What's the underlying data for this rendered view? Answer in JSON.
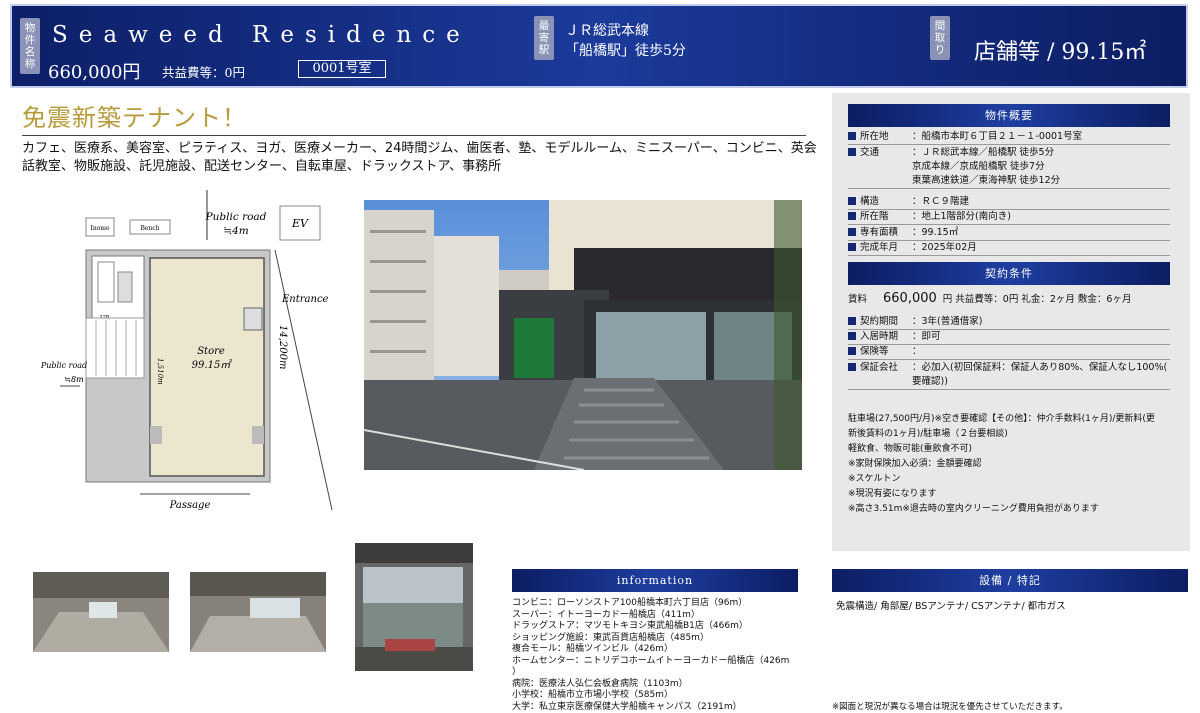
{
  "header": {
    "name_tag": "物件名称",
    "property_name": "Seaweed Residence",
    "price": "660,000円",
    "common_fee": "共益費等：0円",
    "room": "0001号室",
    "station_tag": "最寄駅",
    "line": "ＪＲ総武本線",
    "station": "「船橋駅」徒歩5分",
    "layout_tag": "間取り",
    "layout": "店舗等 / 99.15㎡"
  },
  "catchphrase": "免震新築テナント！",
  "uses": "カフェ、医療系、美容室、ピラティス、ヨガ、医療メーカー、24時間ジム、歯医者、塾、モデルルーム、ミニスーパー、コンビニ、英会話教室、物販施設、託児施設、配送センター、自転車屋、ドラックストア、事務所",
  "floorplan": {
    "inome": "Inome",
    "bench": "Bench",
    "public_road_top": "Public road",
    "road_top_width": "≒4m",
    "ev": "EV",
    "entrance": "Entrance",
    "up": "UP",
    "store": "Store",
    "store_area": "99.15㎡",
    "dim_small": "1,510m",
    "dim_depth": "14,200m",
    "public_road_left": "Public road",
    "road_left_width": "≒8m",
    "passage": "Passage"
  },
  "overview": {
    "title": "物件概要",
    "address_label": "所在地",
    "address": "：船橋市本町６丁目２１－１-0001号室",
    "transport_label": "交通",
    "transport": [
      "：ＪＲ総武本線／船橋駅 徒歩5分",
      "京成本線／京成船橋駅 徒歩7分",
      "東葉高速鉄道／東海神駅 徒歩12分"
    ],
    "structure_label": "構造",
    "structure": "：ＲＣ９階建",
    "floor_label": "所在階",
    "floor": "：地上1階部分(南向き)",
    "area_label": "専有面積",
    "area": "：99.15㎡",
    "completed_label": "完成年月",
    "completed": "：2025年02月"
  },
  "contract": {
    "title": "契約条件",
    "rent_label": "賃料",
    "rent": "660,000",
    "rent_rest": "円 共益費等：0円 礼金：2ヶ月 敷金：6ヶ月",
    "term_label": "契約期間",
    "term": "：3年(普通借家)",
    "movein_label": "入居時期",
    "movein": "：即可",
    "guarantor_label": "保険等",
    "guarantor": "：",
    "company_label": "保証会社",
    "company": "：必加入(初回保証料：保証人あり80%、保証人なし100%(",
    "company2": "要確認))"
  },
  "notes": [
    "駐車場(27,500円/月)※空き要確認【その他】：仲介手数料(1ヶ月)/更新料(更",
    "新後賃料の1ヶ月)/駐車場（２台要相談)",
    "軽飲食、物販可能(重飲食不可)",
    "※家財保険加入必須：金額要確認",
    "※スケルトン",
    "※現況有姿になります",
    "※高さ3.51m※退去時の室内クリーニング費用負担があります"
  ],
  "information": {
    "title": "information",
    "items": [
      "コンビニ：ローソンストア100船橋本町六丁目店（96m）",
      "スーパー：イトーヨーカドー船橋店（411m）",
      "ドラッグストア：マツモトキヨシ東武船橋B1店（466m）",
      "ショッピング施設：東武百貨店船橋店（485m）",
      "複合モール：船橋ツインビル（426m）",
      "ホームセンター：ニトリデコホームイトーヨーカドー船橋店（426m",
      "）",
      "病院：医療法人弘仁会板倉病院（1103m）",
      "小学校：船橋市立市場小学校（585m）",
      "大学：私立東京医療保健大学船橋キャンパス（2191m）"
    ]
  },
  "equipment": {
    "title": "設備 / 特記",
    "text": "免震構造/ 角部屋/ BSアンテナ/ CSアンテナ/ 都市ガス"
  },
  "footnote": "※図面と現況が異なる場合は現況を優先させていただきます。",
  "colors": {
    "navy": "#0d1f68",
    "gold": "#b79b3a",
    "panel": "#e8e8e8",
    "wall": "#aaaaaa",
    "store_fill": "#ece6cf"
  }
}
